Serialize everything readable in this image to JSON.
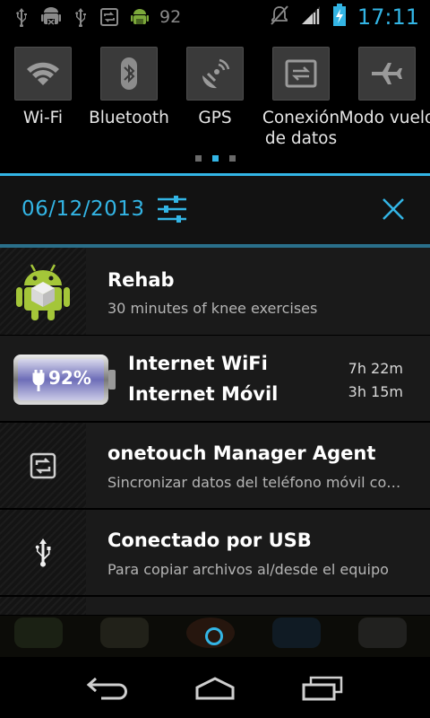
{
  "status_bar": {
    "battery_level": "92",
    "time": "17:11",
    "icons": [
      "usb-icon",
      "android-debug-icon",
      "usb-icon",
      "sync-icon",
      "android-icon",
      "mute-icon",
      "signal-icon",
      "battery-charging-icon"
    ]
  },
  "quick_settings": {
    "tiles": [
      {
        "icon": "wifi-icon",
        "label": "Wi-Fi"
      },
      {
        "icon": "bluetooth-icon",
        "label": "Bluetooth"
      },
      {
        "icon": "gps-icon",
        "label": "GPS"
      },
      {
        "icon": "data-connection-icon",
        "label": "Conexión de datos"
      },
      {
        "icon": "airplane-icon",
        "label": "Modo vuelo"
      }
    ],
    "active_page": 2,
    "page_count": 3
  },
  "header": {
    "date": "06/12/2013"
  },
  "notifications": [
    {
      "icon": "rehab-app-icon",
      "title": "Rehab",
      "text": "30 minutes of knee exercises"
    },
    {
      "icon": "battery-icon",
      "battery_percent": "92%",
      "line1": "Internet WiFi",
      "line2": "Internet Móvil",
      "time1": "7h 22m",
      "time2": "3h 15m"
    },
    {
      "icon": "sync-icon",
      "title": "onetouch Manager Agent",
      "text": "Sincronizar datos del teléfono móvil con…"
    },
    {
      "icon": "usb-icon",
      "title": "Conectado por USB",
      "text": "Para copiar archivos al/desde el equipo"
    }
  ],
  "colors": {
    "accent": "#33b5e5",
    "notification_bg": "#1a1a1a",
    "quick_tile_bg": "#3a3a3a"
  }
}
